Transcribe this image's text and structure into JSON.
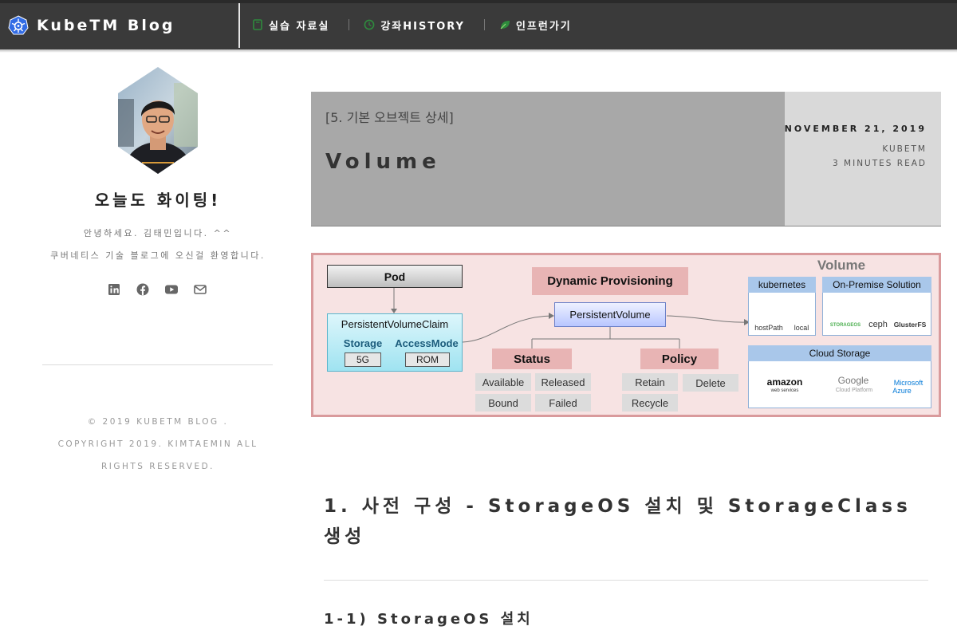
{
  "header": {
    "brand": "KubeTM Blog",
    "nav": [
      {
        "label": "실습 자료실",
        "icon": "book-icon"
      },
      {
        "label": "강좌HISTORY",
        "icon": "clock-icon"
      },
      {
        "label": "인프런가기",
        "icon": "leaf-icon"
      }
    ]
  },
  "sidebar": {
    "title": "오늘도 화이팅!",
    "intro_line1": "안녕하세요. 김태민입니다. ^^",
    "intro_line2": "쿠버네티스 기술 블로그에 오신걸 환영합니다.",
    "social_icons": [
      "linkedin-icon",
      "facebook-icon",
      "youtube-icon",
      "mail-icon"
    ],
    "footer_line1": "© 2019 KUBETM BLOG .",
    "footer_line2": "COPYRIGHT 2019. KIMTAEMIN ALL",
    "footer_line3": "RIGHTS RESERVED."
  },
  "post": {
    "category": "[5. 기본 오브젝트 상세]",
    "title": "Volume",
    "date": "NOVEMBER 21, 2019",
    "author": "KUBETM",
    "read_time": "3 MINUTES READ"
  },
  "diagram": {
    "volume_title": "Volume",
    "pod": "Pod",
    "pvc": "PersistentVolumeClaim",
    "pvc_storage_label": "Storage",
    "pvc_storage_value": "5G",
    "pvc_access_label": "AccessMode",
    "pvc_access_value": "ROM",
    "dynamic": "Dynamic Provisioning",
    "pv": "PersistentVolume",
    "status": "Status",
    "status_items": [
      "Available",
      "Released",
      "Bound",
      "Failed"
    ],
    "policy": "Policy",
    "policy_items": [
      "Retain",
      "Delete",
      "Recycle"
    ],
    "kubernetes": "kubernetes",
    "kubernetes_items": [
      "hostPath",
      "local"
    ],
    "onprem": "On-Premise Solution",
    "onprem_items": [
      "STORAGEOS",
      "ceph",
      "GlusterFS"
    ],
    "cloud": "Cloud Storage",
    "cloud_items": [
      "amazon",
      "web services",
      "Google",
      "Cloud Platform",
      "Microsoft",
      "Azure"
    ]
  },
  "article": {
    "h1": "1. 사전 구성 - StorageOS 설치 및 StorageClass 생성",
    "h2": "1-1) StorageOS 설치"
  },
  "colors": {
    "topbar": "#3a3a3a",
    "header_bg": "#a8a8a8",
    "meta_bg": "#d9d9d9",
    "diagram_border": "#d99a9c",
    "diagram_bg": "#f7e3e3",
    "k8s_blue": "#326ce5"
  }
}
